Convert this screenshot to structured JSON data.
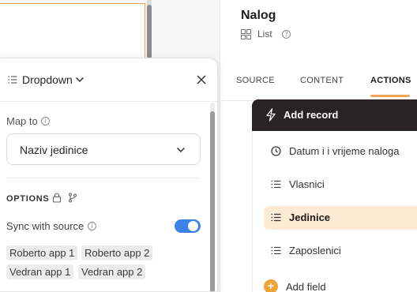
{
  "panel": {
    "title": "Dropdown",
    "map_to_label": "Map to",
    "map_to_value": "Naziv jedinice",
    "options_heading": "OPTIONS",
    "sync_label": "Sync with source",
    "sync_enabled": true,
    "chips": [
      "Roberto app 1",
      "Roberto app 2",
      "Vedran app 1",
      "Vedran app 2"
    ]
  },
  "header": {
    "title": "Nalog",
    "view_label": "List"
  },
  "tabs": [
    {
      "label": "SOURCE",
      "active": false
    },
    {
      "label": "CONTENT",
      "active": false
    },
    {
      "label": "ACTIONS",
      "active": true
    }
  ],
  "actions": {
    "add_record_label": "Add record",
    "fields": [
      {
        "label": "Datum i i vrijeme naloga",
        "icon": "clock-icon",
        "active": false
      },
      {
        "label": "Vlasnici",
        "icon": "list-icon",
        "active": false
      },
      {
        "label": "Jedinice",
        "icon": "list-icon",
        "active": true
      },
      {
        "label": "Zaposlenici",
        "icon": "list-icon",
        "active": false
      }
    ],
    "add_field_label": "Add field"
  },
  "colors": {
    "accent": "#f0a358",
    "toggle": "#3b82e8",
    "dark_header": "#2b2226",
    "active_row": "#fdebd6"
  }
}
